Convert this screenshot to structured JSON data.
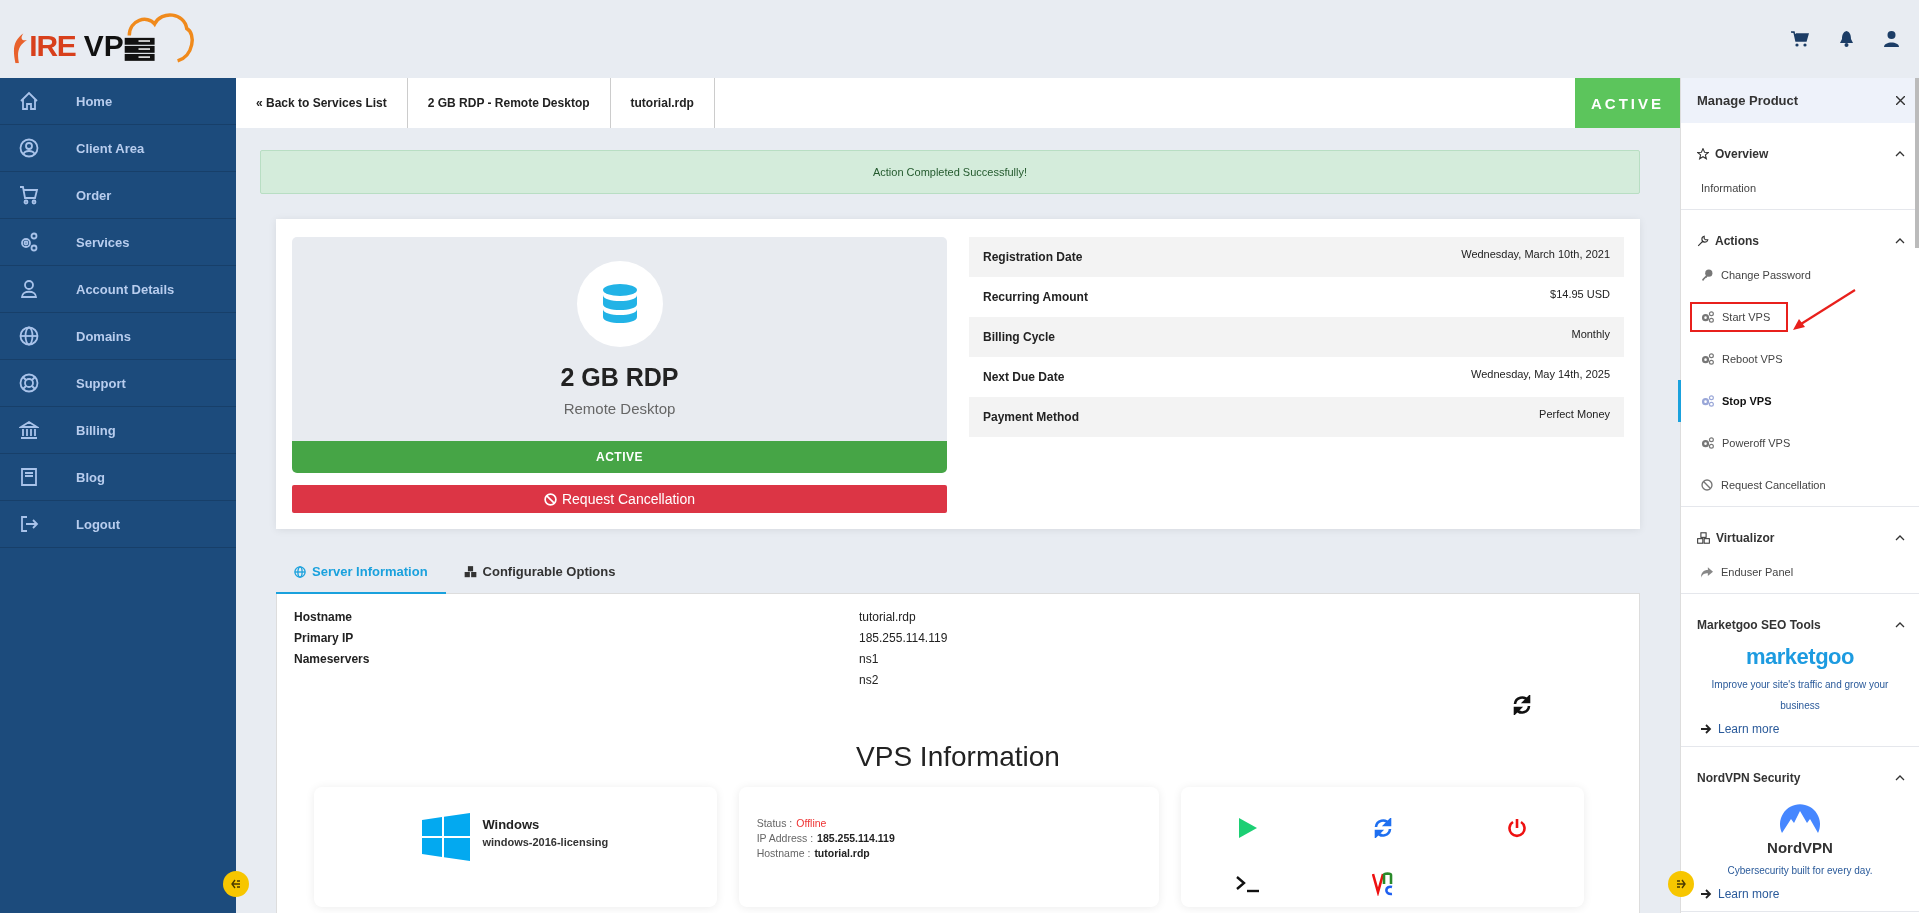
{
  "header": {
    "logo_fire": "IRE",
    "logo_vps": "VP"
  },
  "sidebar": {
    "items": [
      {
        "label": "Home",
        "selected": false
      },
      {
        "label": "Client Area",
        "selected": false
      },
      {
        "label": "Order",
        "selected": false
      },
      {
        "label": "Services",
        "selected": false
      },
      {
        "label": "Account Details",
        "selected": false
      },
      {
        "label": "Domains",
        "selected": false
      },
      {
        "label": "Support",
        "selected": false
      },
      {
        "label": "Billing",
        "selected": false
      },
      {
        "label": "Blog",
        "selected": false
      },
      {
        "label": "Logout",
        "selected": false
      }
    ]
  },
  "breadcrumb": [
    "« Back to Services List",
    "2 GB RDP - Remote Desktop",
    "tutorial.rdp"
  ],
  "status_badge": "ACTIVE",
  "alert": "Action Completed Successfully!",
  "product": {
    "name": "2 GB RDP",
    "group": "Remote Desktop",
    "status": "ACTIVE",
    "cancel_button": "Request Cancellation"
  },
  "details": [
    {
      "label": "Registration Date",
      "value": "Wednesday, March 10th, 2021"
    },
    {
      "label": "Recurring Amount",
      "value": "$14.95 USD"
    },
    {
      "label": "Billing Cycle",
      "value": "Monthly"
    },
    {
      "label": "Next Due Date",
      "value": "Wednesday, May 14th, 2025"
    },
    {
      "label": "Payment Method",
      "value": "Perfect Money"
    }
  ],
  "tabs": [
    {
      "label": "Server Information",
      "selected": true
    },
    {
      "label": "Configurable Options",
      "selected": false
    }
  ],
  "server_info": [
    {
      "label": "Hostname",
      "values": [
        "tutorial.rdp"
      ]
    },
    {
      "label": "Primary IP",
      "values": [
        "185.255.114.119"
      ]
    },
    {
      "label": "Nameservers",
      "values": [
        "ns1",
        "ns2"
      ]
    }
  ],
  "vps": {
    "title": "VPS Information",
    "os_name": "Windows",
    "os_template": "windows-2016-licensing",
    "status_label": "Status :",
    "status": "Offline",
    "ip_label": "IP Address :",
    "ip": "185.255.114.119",
    "hostname_label": "Hostname :",
    "hostname": "tutorial.rdp"
  },
  "manage": {
    "title": "Manage Product",
    "sections": [
      {
        "kind": "links",
        "title": "Overview",
        "expanded": true,
        "items": [
          {
            "label": "Information",
            "selected": false,
            "annotated": false
          }
        ]
      },
      {
        "kind": "links",
        "title": "Actions",
        "expanded": true,
        "items": [
          {
            "label": "Change Password",
            "selected": false,
            "annotated": false
          },
          {
            "label": "Start VPS",
            "selected": false,
            "annotated": true
          },
          {
            "label": "Reboot VPS",
            "selected": false,
            "annotated": false
          },
          {
            "label": "Stop VPS",
            "selected": true,
            "annotated": false
          },
          {
            "label": "Poweroff VPS",
            "selected": false,
            "annotated": false
          },
          {
            "label": "Request Cancellation",
            "selected": false,
            "annotated": false
          }
        ]
      },
      {
        "kind": "links",
        "title": "Virtualizor",
        "expanded": true,
        "items": [
          {
            "label": "Enduser Panel",
            "selected": false,
            "annotated": false
          }
        ]
      },
      {
        "kind": "promo",
        "title": "Marketgoo SEO Tools",
        "expanded": true,
        "brand": "marketgoo",
        "text": "Improve your site's traffic and grow your business",
        "link": "Learn more"
      },
      {
        "kind": "promo",
        "title": "NordVPN Security",
        "expanded": true,
        "brand": "NordVPN",
        "text": "Cybersecurity built for every day.",
        "link": "Learn more"
      }
    ]
  }
}
